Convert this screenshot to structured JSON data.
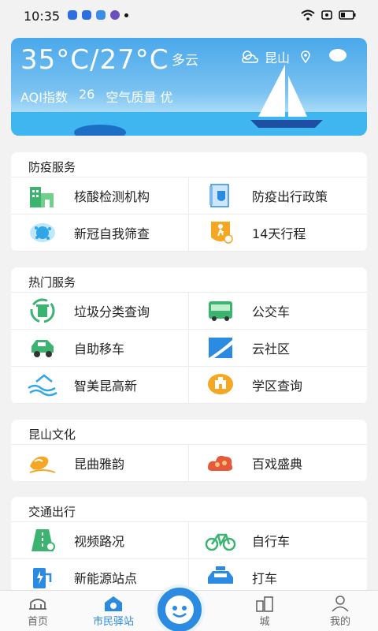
{
  "status": {
    "time": "10:35",
    "dot_colors": [
      "#2b6fe0",
      "#2b6fe0",
      "#3a8de8",
      "#6a4fbd"
    ]
  },
  "weather": {
    "high": "35°C",
    "low": "27°C",
    "condition": "多云",
    "city": "昆山",
    "aqi_label": "AQI指数",
    "aqi_value": "26",
    "quality_label": "空气质量",
    "quality_value": "优"
  },
  "sections": [
    {
      "title": "防疫服务",
      "items": [
        {
          "label": "核酸检测机构",
          "icon": "building-icon",
          "color": "#3cb371"
        },
        {
          "label": "防疫出行政策",
          "icon": "policy-document-icon",
          "color": "#2b8be0"
        },
        {
          "label": "新冠自我筛查",
          "icon": "virus-icon",
          "color": "#2fa7e6"
        },
        {
          "label": "14天行程",
          "icon": "walking-person-icon",
          "color": "#f5a623"
        }
      ]
    },
    {
      "title": "热门服务",
      "items": [
        {
          "label": "垃圾分类查询",
          "icon": "recycle-bin-icon",
          "color": "#3cb371"
        },
        {
          "label": "公交车",
          "icon": "bus-icon",
          "color": "#3cb371"
        },
        {
          "label": "自助移车",
          "icon": "car-icon",
          "color": "#3cb371"
        },
        {
          "label": "云社区",
          "icon": "cloud-community-icon",
          "color": "#2b8be0"
        },
        {
          "label": "智美昆高新",
          "icon": "house-wave-icon",
          "color": "#2fa7e6"
        },
        {
          "label": "学区查询",
          "icon": "school-icon",
          "color": "#f5a623"
        }
      ]
    },
    {
      "title": "昆山文化",
      "items": [
        {
          "label": "昆曲雅韵",
          "icon": "opera-icon",
          "color": "#f5a623"
        },
        {
          "label": "百戏盛典",
          "icon": "cloud-pattern-icon",
          "color": "#e45a3a"
        }
      ]
    },
    {
      "title": "交通出行",
      "items": [
        {
          "label": "视频路况",
          "icon": "road-camera-icon",
          "color": "#3cb371"
        },
        {
          "label": "自行车",
          "icon": "bicycle-icon",
          "color": "#3cb371"
        },
        {
          "label": "新能源站点",
          "icon": "charging-station-icon",
          "color": "#2b8be0"
        },
        {
          "label": "打车",
          "icon": "taxi-icon",
          "color": "#2b8be0"
        }
      ]
    }
  ],
  "tabs": [
    {
      "label": "首页",
      "icon": "home-bridge-icon"
    },
    {
      "label": "市民驿站",
      "icon": "station-icon"
    },
    {
      "label": "城",
      "icon": "city-icon"
    },
    {
      "label": "我的",
      "icon": "profile-icon"
    }
  ]
}
